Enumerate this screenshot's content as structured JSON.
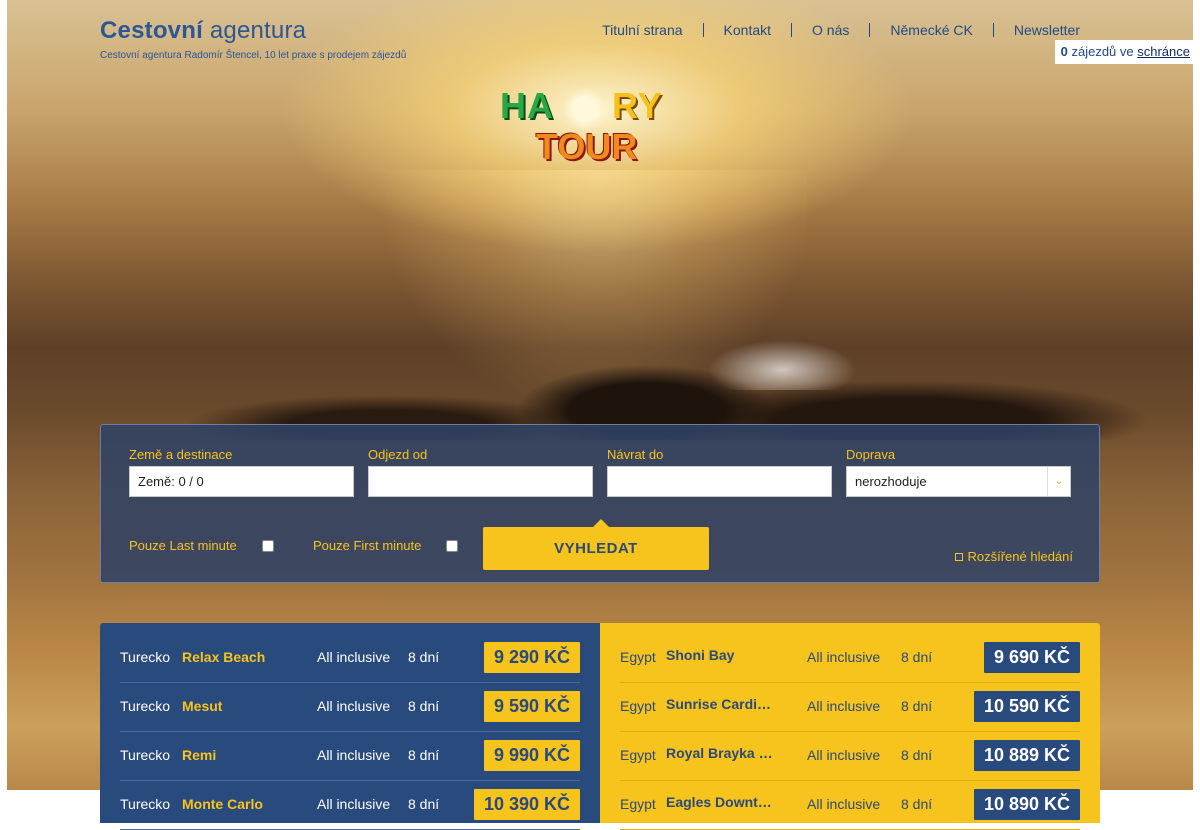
{
  "header": {
    "logo_bold": "Cestovní",
    "logo_light": "agentura",
    "logo_subtitle": "Cestovní agentura Radomír Štencel, 10 let praxe s prodejem zájezdů",
    "nav": [
      "Titulní strana",
      "Kontakt",
      "O nás",
      "Německé CK",
      "Newsletter"
    ],
    "basket_count": "0",
    "basket_text": "zájezdů ve",
    "basket_link": "schránce"
  },
  "brand": {
    "line1_a": "HA",
    "line1_b": "RY",
    "line2": "TOUR"
  },
  "search": {
    "country_label": "Země a destinace",
    "country_value": "Země: 0 / 0",
    "depart_label": "Odjezd od",
    "depart_value": "",
    "return_label": "Návrat do",
    "return_value": "",
    "transport_label": "Doprava",
    "transport_value": "nerozhoduje",
    "last_minute_label": "Pouze Last minute",
    "first_minute_label": "Pouze First minute",
    "search_button": "VYHLEDAT",
    "advanced_label": "Rozšířené hledání"
  },
  "deals_left": [
    {
      "country": "Turecko",
      "hotel": "Relax Beach",
      "board": "All inclusive",
      "days": "8 dní",
      "price": "9 290 KČ"
    },
    {
      "country": "Turecko",
      "hotel": "Mesut",
      "board": "All inclusive",
      "days": "8 dní",
      "price": "9 590 KČ"
    },
    {
      "country": "Turecko",
      "hotel": "Remi",
      "board": "All inclusive",
      "days": "8 dní",
      "price": "9 990 KČ"
    },
    {
      "country": "Turecko",
      "hotel": "Monte Carlo",
      "board": "All inclusive",
      "days": "8 dní",
      "price": "10 390 KČ"
    }
  ],
  "deals_right": [
    {
      "country": "Egypt",
      "hotel": "Shoni Bay",
      "board": "All inclusive",
      "days": "8 dní",
      "price": "9 690 KČ"
    },
    {
      "country": "Egypt",
      "hotel": "Sunrise Cardinal",
      "board": "All inclusive",
      "days": "8 dní",
      "price": "10 590 KČ"
    },
    {
      "country": "Egypt",
      "hotel": "Royal Brayka Beach",
      "board": "All inclusive",
      "days": "8 dní",
      "price": "10 889 KČ"
    },
    {
      "country": "Egypt",
      "hotel": "Eagles Downtown",
      "board": "All inclusive",
      "days": "8 dní",
      "price": "10 890 KČ"
    }
  ]
}
